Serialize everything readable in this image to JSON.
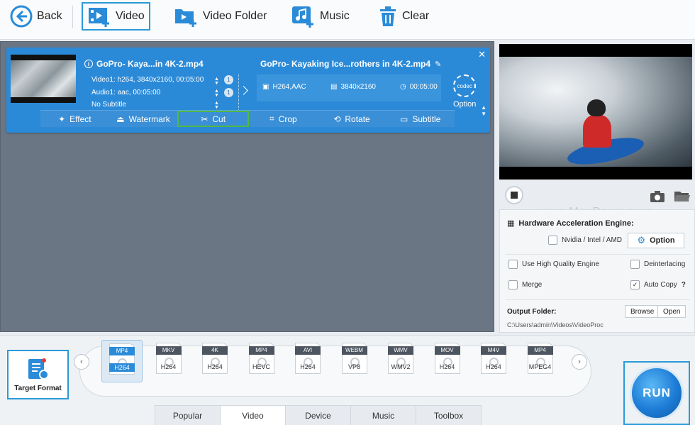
{
  "toolbar": {
    "back": "Back",
    "video": "Video",
    "video_folder": "Video Folder",
    "music": "Music",
    "clear": "Clear"
  },
  "item": {
    "input_name": "GoPro- Kaya...in 4K-2.mp4",
    "video_info": "Video1: h264, 3840x2160, 00:05:00",
    "audio_info": "Audio1: aac, 00:05:00",
    "subtitle_info": "No Subtitle",
    "video_count": "1",
    "audio_count": "1",
    "output_name": "GoPro- Kayaking Ice...rothers in 4K-2.mp4",
    "out_codec": "H264,AAC",
    "out_res": "3840x2160",
    "out_dur": "00:05:00",
    "codec_label": "codec",
    "option_label": "Option"
  },
  "edit_bar": [
    "Effect",
    "Watermark",
    "Cut",
    "Crop",
    "Rotate",
    "Subtitle"
  ],
  "watermark_text": "www.MacDown.com",
  "settings": {
    "hw_title": "Hardware Acceleration Engine:",
    "hw_option": "Nvidia / Intel / AMD",
    "option_btn": "Option",
    "high_quality": "Use High Quality Engine",
    "deinterlacing": "Deinterlacing",
    "merge": "Merge",
    "auto_copy": "Auto Copy",
    "auto_copy_help": "?",
    "output_folder_label": "Output Folder:",
    "browse": "Browse",
    "open": "Open",
    "output_path": "C:\\Users\\admin\\Videos\\VideoProc"
  },
  "target_format": "Target Format",
  "formats": [
    {
      "tag": "MP4",
      "sub": "H264",
      "selected": true
    },
    {
      "tag": "MKV",
      "sub": "H264",
      "selected": false
    },
    {
      "tag": "4K",
      "sub": "H264",
      "selected": false
    },
    {
      "tag": "MP4",
      "sub": "HEVC",
      "selected": false
    },
    {
      "tag": "AVI",
      "sub": "H264",
      "selected": false
    },
    {
      "tag": "WEBM",
      "sub": "VP8",
      "selected": false
    },
    {
      "tag": "WMV",
      "sub": "WMV2",
      "selected": false
    },
    {
      "tag": "MOV",
      "sub": "H264",
      "selected": false
    },
    {
      "tag": "M4V",
      "sub": "H264",
      "selected": false
    },
    {
      "tag": "MP4",
      "sub": "MPEG4",
      "selected": false
    }
  ],
  "tabs": [
    "Popular",
    "Video",
    "Device",
    "Music",
    "Toolbox"
  ],
  "active_tab": "Video",
  "run": "RUN",
  "colors": {
    "accent": "#2a9ad7",
    "card": "#2b8ad8",
    "cut_highlight": "#4fb847"
  }
}
